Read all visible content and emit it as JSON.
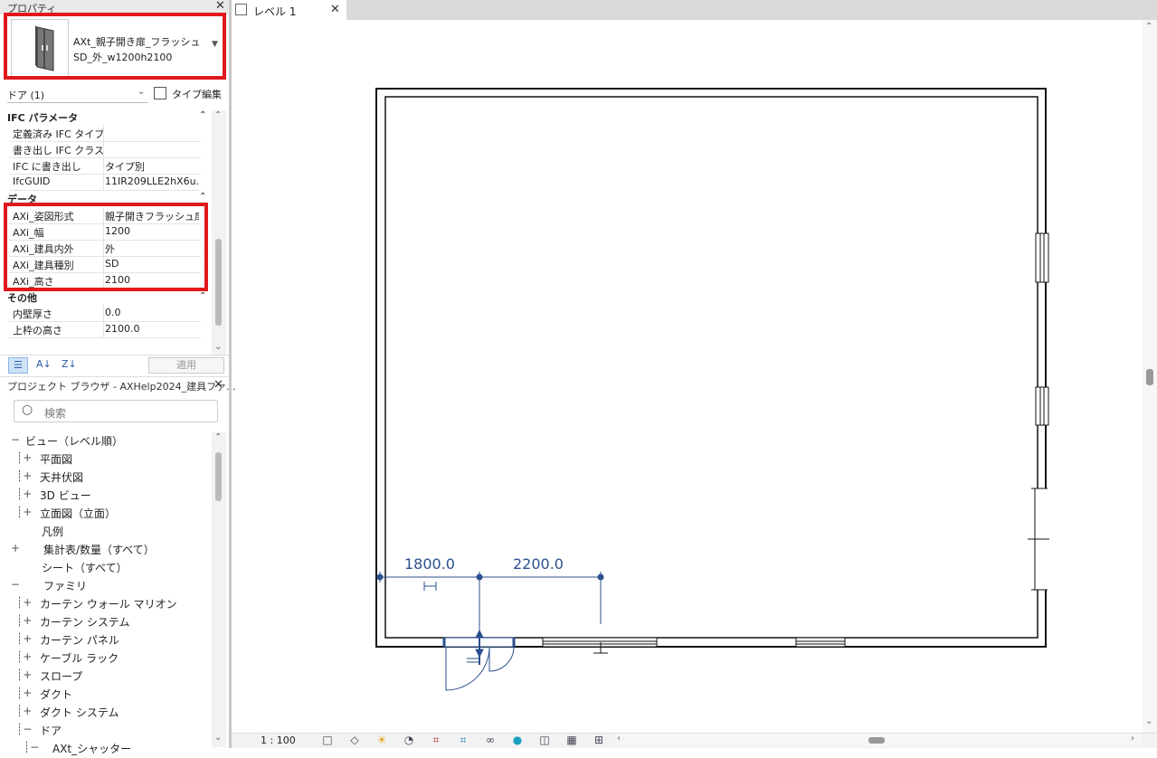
{
  "properties": {
    "title": "プロパティ",
    "family_name_line1": "AXt_親子開き扉_フラッシュ",
    "family_name_line2": "SD_外_w1200h2100",
    "filter": "ドア (1)",
    "type_edit": "タイプ編集",
    "sections": {
      "ifc": "IFC パラメータ",
      "data": "データ",
      "other": "その他"
    },
    "ifc_rows": [
      {
        "k": "定義済み IFC タイプ",
        "v": ""
      },
      {
        "k": "書き出し IFC クラス",
        "v": ""
      },
      {
        "k": "IFC に書き出し",
        "v": "タイプ別"
      },
      {
        "k": "IfcGUID",
        "v": "11IR209LLE2hX6u..."
      }
    ],
    "data_rows": [
      {
        "k": "AXi_姿図形式",
        "v": "親子開きフラッシュ扉"
      },
      {
        "k": "AXi_幅",
        "v": "1200"
      },
      {
        "k": "AXi_建具内外",
        "v": "外"
      },
      {
        "k": "AXi_建具種別",
        "v": "SD"
      },
      {
        "k": "AXi_高さ",
        "v": "2100"
      }
    ],
    "other_rows": [
      {
        "k": "内壁厚さ",
        "v": "0.0"
      },
      {
        "k": "上枠の高さ",
        "v": "2100.0"
      }
    ],
    "apply": "適用"
  },
  "browser": {
    "title": "プロジェクト ブラウザ - AXHelp2024_建具ファ...",
    "search_placeholder": "検索",
    "items": [
      "ビュー（レベル順）",
      "平面図",
      "天井伏図",
      "3D ビュー",
      "立面図（立面）",
      "凡例",
      "集計表/数量（すべて）",
      "シート（すべて）",
      "ファミリ",
      "カーテン ウォール マリオン",
      "カーテン システム",
      "カーテン パネル",
      "ケーブル ラック",
      "スロープ",
      "ダクト",
      "ダクト システム",
      "ドア",
      "AXt_シャッター"
    ]
  },
  "view": {
    "tab": "レベル 1",
    "dim1": "1800.0",
    "dim2": "2200.0",
    "scale": "1 : 100"
  },
  "colors": {
    "highlight": "#e0191c",
    "dimension": "#2a4f8f"
  }
}
